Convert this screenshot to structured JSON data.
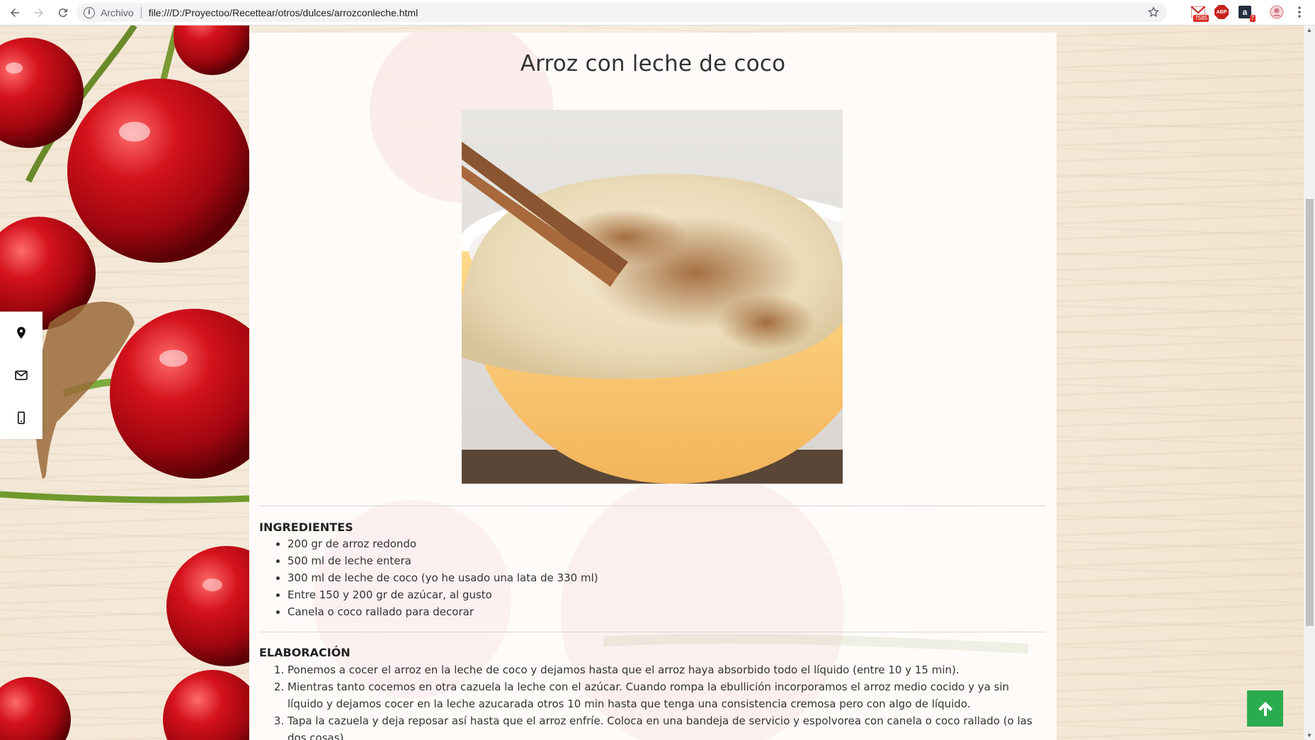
{
  "browser": {
    "scheme_label": "Archivo",
    "url": "file:///D:/Proyectoo/Recettear/otros/dulces/arrozconleche.html",
    "gmail_badge": "7585",
    "ext_badge": "7",
    "ext_abp": "ABP"
  },
  "recipe": {
    "title": "Arroz con leche de coco",
    "ingredients_heading": "INGREDIENTES",
    "ingredients": [
      "200 gr de arroz redondo",
      "500 ml de leche entera",
      "300 ml de leche de coco (yo he usado una lata de 330 ml)",
      "Entre 150 y 200 gr de azúcar, al gusto",
      "Canela o coco rallado para decorar"
    ],
    "steps_heading": "ELABORACIÓN",
    "steps": [
      "Ponemos a cocer el arroz en la leche de coco y dejamos hasta que el arroz haya absorbido todo el líquido (entre 10 y 15 min).",
      "Mientras tanto cocemos en otra cazuela la leche con el azúcar. Cuando rompa la ebullición incorporamos el arroz medio cocido y ya sin líquido y dejamos cocer en la leche azucarada otros 10 min hasta que tenga una consistencia cremosa pero con algo de líquido.",
      "Tapa la cazuela y deja reposar así hasta que el arroz enfríe. Coloca en una bandeja de servicio y espolvorea con canela o coco rallado (o las dos cosas)."
    ]
  },
  "icons": {
    "back": "arrow-left-icon",
    "forward": "arrow-right-icon",
    "reload": "reload-icon",
    "info": "info-icon",
    "bookmark": "star-icon",
    "menu": "kebab-icon",
    "location": "map-pin-icon",
    "email": "envelope-icon",
    "phone": "mobile-phone-icon",
    "to_top": "arrow-up-icon"
  },
  "colors": {
    "accent_green": "#2bab4f",
    "cherry_red": "#c8101c",
    "title_text": "#333333"
  }
}
